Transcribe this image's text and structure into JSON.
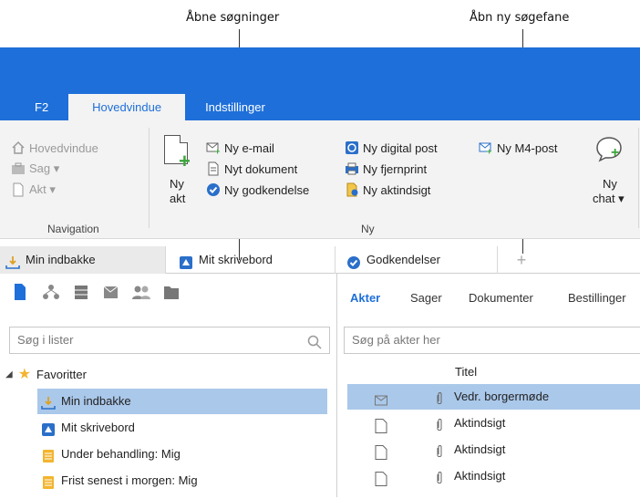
{
  "callouts": {
    "open_searches": "Åbne søgninger",
    "open_new_search_tab": "Åbn ny søgefane"
  },
  "ribbon_tabs": [
    {
      "label": "F2",
      "active": false
    },
    {
      "label": "Hovedvindue",
      "active": true
    },
    {
      "label": "Indstillinger",
      "active": false
    }
  ],
  "navigation": {
    "items": [
      "Hovedvindue",
      "Sag ▾",
      "Akt ▾"
    ],
    "group_label": "Navigation"
  },
  "ny_group": {
    "big_button_line1": "Ny",
    "big_button_line2": "akt",
    "col1": [
      "Ny e-mail",
      "Nyt dokument",
      "Ny godkendelse"
    ],
    "col2": [
      "Ny digital post",
      "Ny fjernprint",
      "Ny aktindsigt"
    ],
    "col3": [
      "Ny M4-post"
    ],
    "chat_line1": "Ny",
    "chat_line2": "chat ▾",
    "group_label": "Ny"
  },
  "doc_tabs": [
    "Min indbakke",
    "Mit skrivebord",
    "Godkendelser"
  ],
  "left_pane": {
    "search_placeholder": "Søg i lister",
    "favorites_label": "Favoritter",
    "items": [
      "Min indbakke",
      "Mit skrivebord",
      "Under behandling: Mig",
      "Frist senest i morgen: Mig"
    ]
  },
  "right_pane": {
    "subtabs": [
      "Akter",
      "Sager",
      "Dokumenter",
      "Bestillinger"
    ],
    "search_placeholder": "Søg på akter her",
    "column_title": "Titel",
    "rows": [
      "Vedr. borgermøde",
      "Aktindsigt",
      "Aktindsigt",
      "Aktindsigt"
    ]
  },
  "colors": {
    "brand_blue": "#1e6fd9",
    "selection": "#aac8ea",
    "green": "#3aa53a",
    "ribbon_bg": "#f3f3f3"
  }
}
